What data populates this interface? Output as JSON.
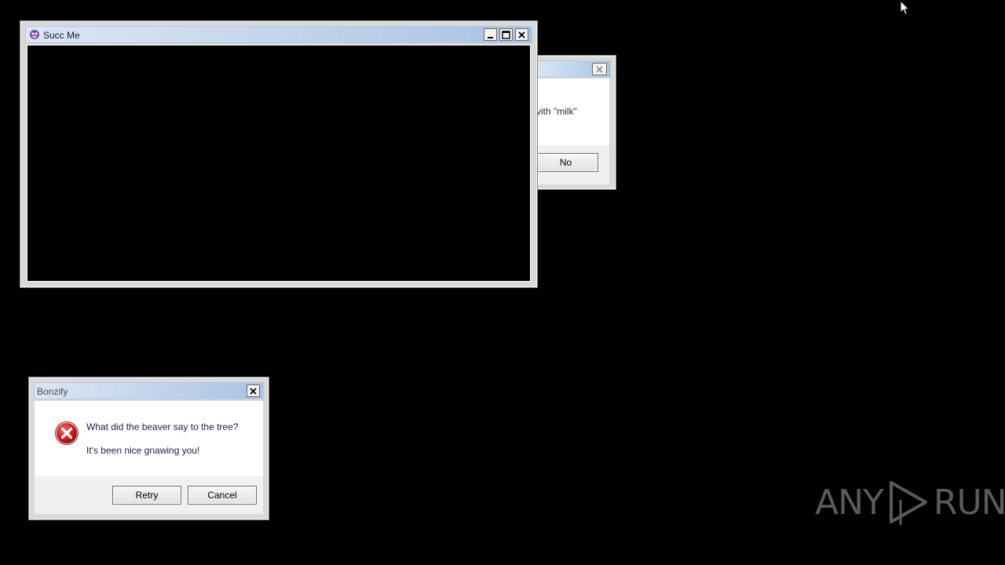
{
  "windows": {
    "succ_me": {
      "title": "Succ Me"
    },
    "bonzify": {
      "title": "Bonzify",
      "message_line1": "What did the beaver say to the tree?",
      "message_line2": "It's been nice gnawing you!",
      "retry_label": "Retry",
      "cancel_label": "Cancel",
      "icon": "error-icon"
    },
    "background_dialog": {
      "partial_message": "vith \"milk\"",
      "no_label": "No"
    }
  },
  "watermark": {
    "left": "ANY",
    "right": "RUN"
  },
  "colors": {
    "desktop": "#000000",
    "title_gradient_start": "#dbe6f4",
    "title_gradient_end": "#a9c2e3"
  }
}
